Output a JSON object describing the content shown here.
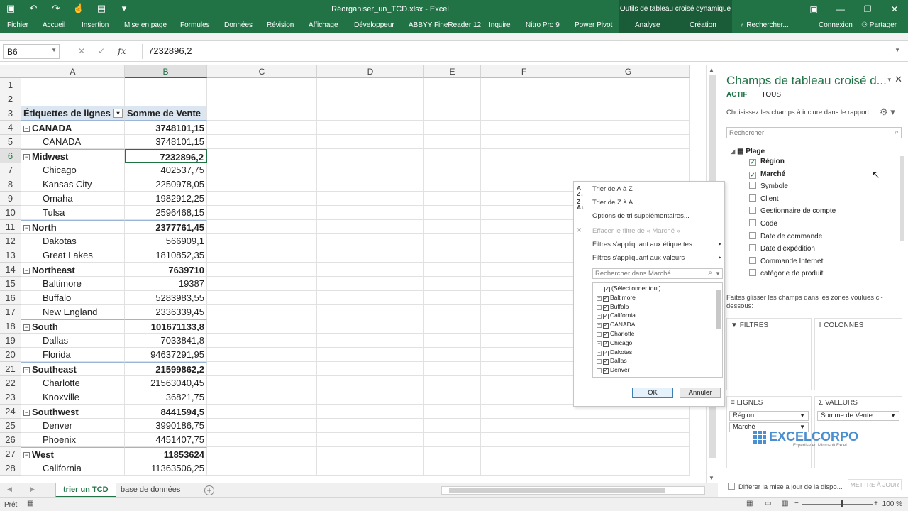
{
  "window": {
    "title": "Réorganiser_un_TCD.xlsx - Excel",
    "context_tools": "Outils de tableau croisé dynamique"
  },
  "ribbon": {
    "tabs": [
      "Fichier",
      "Accueil",
      "Insertion",
      "Mise en page",
      "Formules",
      "Données",
      "Révision",
      "Affichage",
      "Développeur",
      "ABBYY FineReader 12",
      "Inquire",
      "Nitro Pro 9",
      "Power Pivot"
    ],
    "context_tabs": [
      "Analyse",
      "Création"
    ],
    "search_placeholder": "Rechercher...",
    "signin": "Connexion",
    "share": "Partager"
  },
  "formula_bar": {
    "name_box": "B6",
    "value": "7232896,2"
  },
  "columns": [
    "A",
    "B",
    "C",
    "D",
    "E",
    "F",
    "G"
  ],
  "rows": [
    {
      "n": "1",
      "a": "",
      "b": "",
      "type": "empty"
    },
    {
      "n": "2",
      "a": "",
      "b": "",
      "type": "empty"
    },
    {
      "n": "3",
      "a": "Étiquettes de lignes",
      "b": "Somme de Vente",
      "type": "header"
    },
    {
      "n": "4",
      "a": "CANADA",
      "b": "3748101,15",
      "type": "group"
    },
    {
      "n": "5",
      "a": "CANADA",
      "b": "3748101,15",
      "type": "item"
    },
    {
      "n": "6",
      "a": "Midwest",
      "b": "7232896,2",
      "type": "group"
    },
    {
      "n": "7",
      "a": "Chicago",
      "b": "402537,75",
      "type": "item"
    },
    {
      "n": "8",
      "a": "Kansas City",
      "b": "2250978,05",
      "type": "item"
    },
    {
      "n": "9",
      "a": "Omaha",
      "b": "1982912,25",
      "type": "item"
    },
    {
      "n": "10",
      "a": "Tulsa",
      "b": "2596468,15",
      "type": "item"
    },
    {
      "n": "11",
      "a": "North",
      "b": "2377761,45",
      "type": "group"
    },
    {
      "n": "12",
      "a": "Dakotas",
      "b": "566909,1",
      "type": "item"
    },
    {
      "n": "13",
      "a": "Great Lakes",
      "b": "1810852,35",
      "type": "item"
    },
    {
      "n": "14",
      "a": "Northeast",
      "b": "7639710",
      "type": "group"
    },
    {
      "n": "15",
      "a": "Baltimore",
      "b": "19387",
      "type": "item"
    },
    {
      "n": "16",
      "a": "Buffalo",
      "b": "5283983,55",
      "type": "item"
    },
    {
      "n": "17",
      "a": "New England",
      "b": "2336339,45",
      "type": "item"
    },
    {
      "n": "18",
      "a": "South",
      "b": "101671133,8",
      "type": "group"
    },
    {
      "n": "19",
      "a": "Dallas",
      "b": "7033841,8",
      "type": "item"
    },
    {
      "n": "20",
      "a": "Florida",
      "b": "94637291,95",
      "type": "item"
    },
    {
      "n": "21",
      "a": "Southeast",
      "b": "21599862,2",
      "type": "group"
    },
    {
      "n": "22",
      "a": "Charlotte",
      "b": "21563040,45",
      "type": "item"
    },
    {
      "n": "23",
      "a": "Knoxville",
      "b": "36821,75",
      "type": "item"
    },
    {
      "n": "24",
      "a": "Southwest",
      "b": "8441594,5",
      "type": "group"
    },
    {
      "n": "25",
      "a": "Denver",
      "b": "3990186,75",
      "type": "item"
    },
    {
      "n": "26",
      "a": "Phoenix",
      "b": "4451407,75",
      "type": "item"
    },
    {
      "n": "27",
      "a": "West",
      "b": "11853624",
      "type": "group"
    },
    {
      "n": "28",
      "a": "California",
      "b": "11363506,25",
      "type": "item"
    }
  ],
  "sheets": [
    "trier un TCD",
    "base de données"
  ],
  "status": {
    "ready": "Prêt",
    "zoom": "100 %"
  },
  "filter_menu": {
    "sort_az": "Trier de A à Z",
    "sort_za": "Trier de Z à A",
    "more_sort": "Options de tri supplémentaires...",
    "clear_filter": "Effacer le filtre de « Marché »",
    "label_filters": "Filtres s'appliquant aux étiquettes",
    "value_filters": "Filtres s'appliquant aux valeurs",
    "search_placeholder": "Rechercher dans Marché",
    "items": [
      "(Sélectionner tout)",
      "Baltimore",
      "Buffalo",
      "California",
      "CANADA",
      "Charlotte",
      "Chicago",
      "Dakotas",
      "Dallas",
      "Denver"
    ],
    "ok": "OK",
    "cancel": "Annuler"
  },
  "pivot_panel": {
    "title": "Champs de tableau croisé d...",
    "tab_active": "ACTIF",
    "tab_all": "TOUS",
    "choose": "Choisissez les champs à inclure dans le rapport :",
    "search_placeholder": "Rechercher",
    "table_name": "Plage",
    "fields": [
      {
        "label": "Région",
        "checked": true
      },
      {
        "label": "Marché",
        "checked": true
      },
      {
        "label": "Symbole",
        "checked": false
      },
      {
        "label": "Client",
        "checked": false
      },
      {
        "label": "Gestionnaire de compte",
        "checked": false
      },
      {
        "label": "Code",
        "checked": false
      },
      {
        "label": "Date de commande",
        "checked": false
      },
      {
        "label": "Date d'expédition",
        "checked": false
      },
      {
        "label": "Commande Internet",
        "checked": false
      },
      {
        "label": "catégorie de produit",
        "checked": false
      }
    ],
    "drag_hint": "Faites glisser les champs dans les zones voulues ci-dessous:",
    "zone_filters": "FILTRES",
    "zone_columns": "COLONNES",
    "zone_rows": "LIGNES",
    "zone_values": "VALEURS",
    "rows_fields": [
      "Région",
      "Marché"
    ],
    "values_fields": [
      "Somme de Vente"
    ],
    "defer": "Différer la mise à jour de la dispo...",
    "update": "METTRE À JOUR"
  },
  "watermark": {
    "name": "EXCELCORPO",
    "tagline": "Expertise en Microsoft Excel"
  },
  "colors": {
    "excel_green": "#217346",
    "context_green": "#1a5c38",
    "pivot_header": "#dce6f1"
  }
}
